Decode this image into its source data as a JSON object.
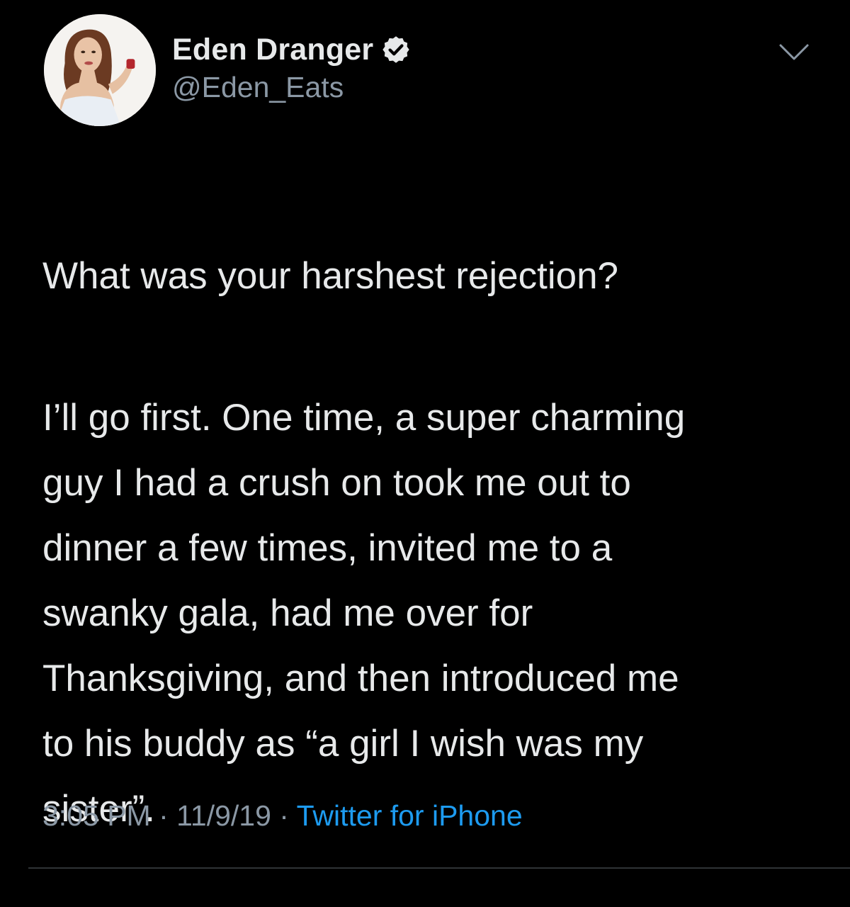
{
  "author": {
    "display_name": "Eden Dranger",
    "handle": "@Eden_Eats",
    "verified": true,
    "avatar_icon": "profile-photo"
  },
  "tweet": {
    "paragraphs": [
      "What was your harshest rejection?",
      "I’ll go first. One time, a super charming\nguy I had a crush on took me out to\ndinner a few times, invited me to a\nswanky gala, had me over for\nThanksgiving, and then introduced me\nto his buddy as “a girl I wish was my\nsister”."
    ]
  },
  "meta": {
    "time": "3:05 PM",
    "separator": " · ",
    "date": "11/9/19",
    "source": "Twitter for iPhone"
  },
  "colors": {
    "background": "#000000",
    "primary_text": "#e7e9ea",
    "secondary_text": "#8b98a5",
    "link": "#1d9bf0",
    "verified_badge": "#e7e9ea"
  },
  "icons": {
    "menu": "chevron-down-icon",
    "badge": "verified-badge-icon"
  }
}
